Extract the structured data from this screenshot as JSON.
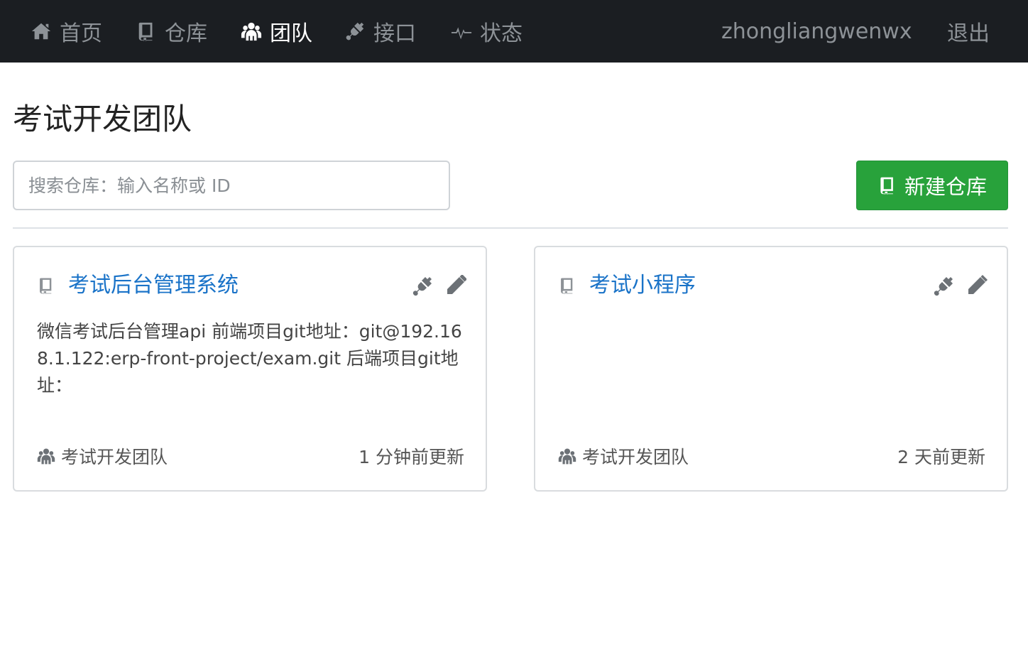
{
  "nav": {
    "items": [
      {
        "label": "首页",
        "icon": "home-icon"
      },
      {
        "label": "仓库",
        "icon": "book-icon"
      },
      {
        "label": "团队",
        "icon": "team-icon"
      },
      {
        "label": "接口",
        "icon": "plug-icon"
      },
      {
        "label": "状态",
        "icon": "pulse-icon"
      }
    ],
    "active": "团队",
    "username": "zhongliangwenwx",
    "logout_label": "退出"
  },
  "page": {
    "title": "考试开发团队"
  },
  "search": {
    "placeholder": "搜索仓库：输入名称或 ID",
    "value": ""
  },
  "actions": {
    "new_repo_label": "新建仓库"
  },
  "repos": [
    {
      "name": "考试后台管理系统",
      "description": "微信考试后台管理api 前端项目git地址：git@192.168.1.122:erp-front-project/exam.git 后端项目git地址：",
      "team": "考试开发团队",
      "updated": "1 分钟前更新"
    },
    {
      "name": "考试小程序",
      "description": "",
      "team": "考试开发团队",
      "updated": "2 天前更新"
    }
  ],
  "colors": {
    "navbar_bg": "#1b1e22",
    "nav_text": "#8d9297",
    "nav_active": "#ffffff",
    "link_blue": "#1a73c8",
    "success_green": "#28a23b",
    "border": "#d9dcdf"
  }
}
